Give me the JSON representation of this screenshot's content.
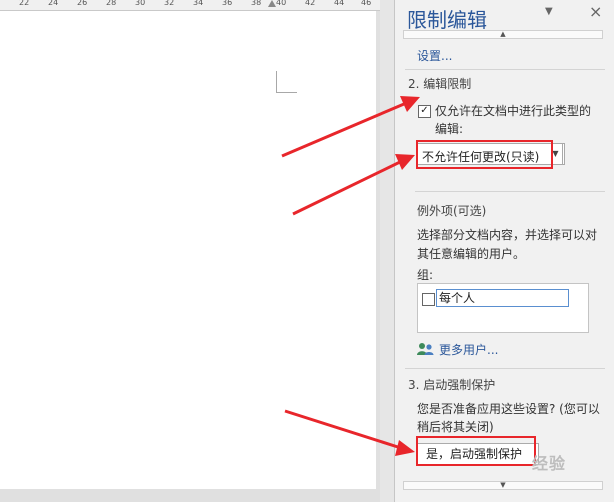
{
  "ruler": {
    "labels": [
      "22",
      "24",
      "26",
      "28",
      "30",
      "32",
      "34",
      "36",
      "38",
      "40",
      "42",
      "44",
      "46"
    ]
  },
  "pane": {
    "title": "限制编辑",
    "dropdown_glyph": "▼",
    "close_glyph": "×",
    "scroll_up_glyph": "▲",
    "scroll_down_glyph": "▼",
    "settings_link": "设置...",
    "section2": {
      "heading": "2. 编辑限制",
      "checkbox_checked": true,
      "checkbox_glyph": "✓",
      "checkbox_label": "仅允许在文档中进行此类型的编辑:",
      "edit_type_value": "不允许任何更改(只读)",
      "dropdown_arrow": "▼",
      "exceptions_heading": "例外项(可选)",
      "exceptions_desc": "选择部分文档内容，并选择可以对其任意编辑的用户。",
      "groups_label": "组:",
      "groups": [
        {
          "name": "每个人",
          "checked": false
        }
      ],
      "more_users": "更多用户..."
    },
    "section3": {
      "heading": "3. 启动强制保护",
      "question": "您是否准备应用这些设置? (您可以稍后将其关闭)",
      "button_label": "是，启动强制保护"
    }
  },
  "annotations": {
    "highlight_color": "#e8262b"
  },
  "watermark": "经验",
  "colors": {
    "accent": "#2b579a",
    "pane_bg": "#f1f1f1",
    "annotation": "#e8262b"
  }
}
